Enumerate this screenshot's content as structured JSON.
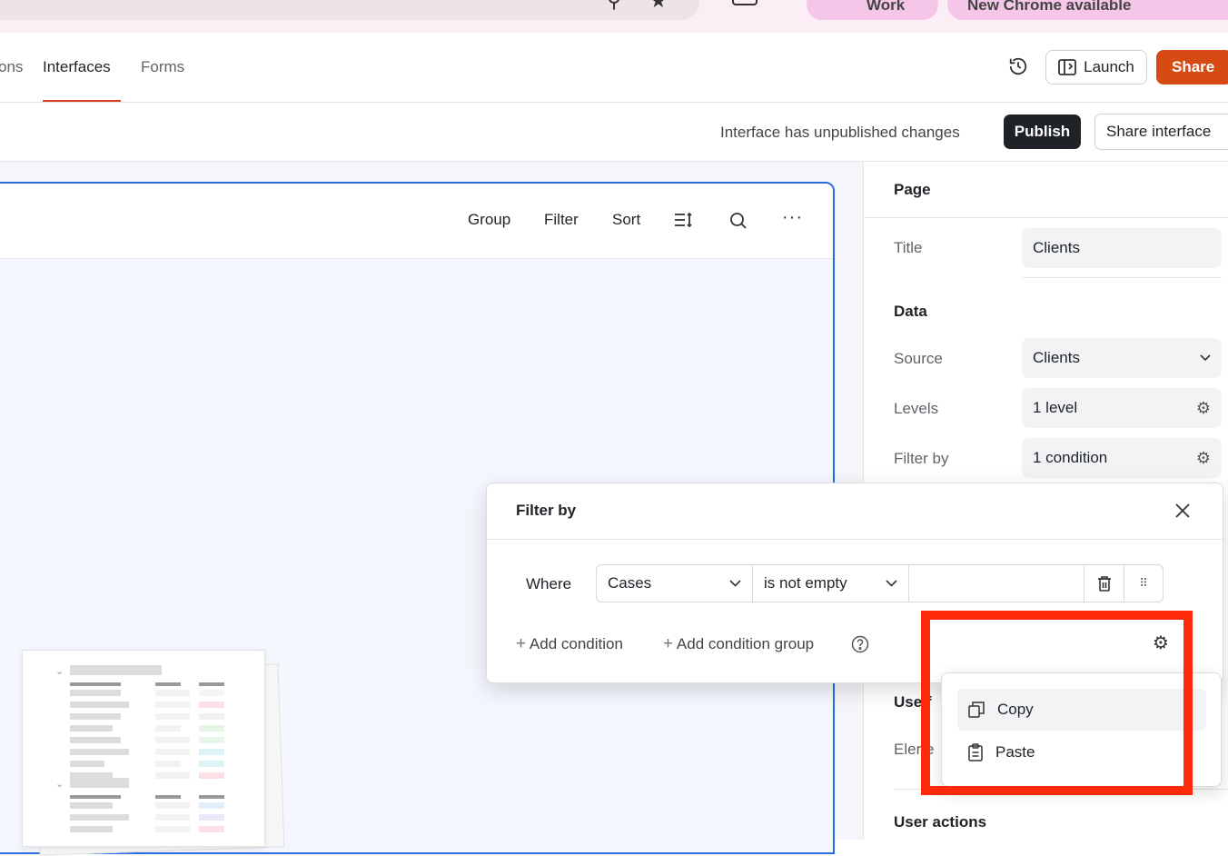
{
  "browser": {
    "pill_left_label": "Work",
    "pill_right_label": "New Chrome available"
  },
  "nav": {
    "tabs": [
      {
        "label": "ons"
      },
      {
        "label": "Interfaces"
      },
      {
        "label": "Forms"
      }
    ],
    "launch_label": "Launch",
    "share_label": "Share"
  },
  "status": {
    "message": "Interface has unpublished changes",
    "publish_label": "Publish",
    "share_interface_label": "Share interface"
  },
  "toolbar": {
    "group_label": "Group",
    "filter_label": "Filter",
    "sort_label": "Sort"
  },
  "panel": {
    "page_heading": "Page",
    "title_label": "Title",
    "title_value": "Clients",
    "data_heading": "Data",
    "source_label": "Source",
    "source_value": "Clients",
    "levels_label": "Levels",
    "levels_value": "1 level",
    "filterby_label": "Filter by",
    "filterby_value": "1 condition",
    "user_filters_partial": "Use  f",
    "elements_partial": "Eler  e",
    "user_actions_heading": "User actions"
  },
  "filter_popover": {
    "title": "Filter by",
    "where_label": "Where",
    "field_value": "Cases",
    "operator_value": "is not empty",
    "value_input": "",
    "add_condition_label": "Add condition",
    "add_condition_group_label": "Add condition group"
  },
  "context_menu": {
    "items": [
      {
        "label": "Copy"
      },
      {
        "label": "Paste"
      }
    ]
  },
  "colors": {
    "accent_red": "#d93b24",
    "share_orange": "#d64a14",
    "selection_blue": "#2c6be0",
    "highlight_red": "#ff2a0a"
  }
}
